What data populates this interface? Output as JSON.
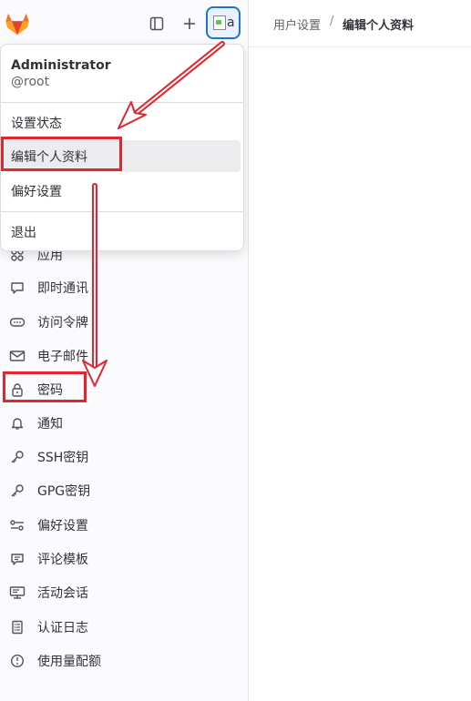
{
  "header": {
    "breadcrumb": [
      "用户设置",
      "编辑个人资料"
    ],
    "separator": "/"
  },
  "topbar": {
    "avatar_alt": "a",
    "icons": [
      "gitlab-logo",
      "sidebar-toggle-icon",
      "plus-icon",
      "avatar"
    ]
  },
  "user_menu": {
    "name": "Administrator",
    "username": "@root",
    "items": [
      "设置状态",
      "编辑个人资料",
      "偏好设置",
      "退出"
    ],
    "highlighted": "编辑个人资料"
  },
  "sidebar": {
    "items": [
      {
        "label": "应用",
        "icon": "applications-icon"
      },
      {
        "label": "即时通讯",
        "icon": "comment-icon"
      },
      {
        "label": "访问令牌",
        "icon": "token-icon"
      },
      {
        "label": "电子邮件",
        "icon": "mail-icon"
      },
      {
        "label": "密码",
        "icon": "lock-icon"
      },
      {
        "label": "通知",
        "icon": "bell-icon"
      },
      {
        "label": "SSH密钥",
        "icon": "key-icon"
      },
      {
        "label": "GPG密钥",
        "icon": "key-icon"
      },
      {
        "label": "偏好设置",
        "icon": "preferences-icon"
      },
      {
        "label": "评论模板",
        "icon": "comment-template-icon"
      },
      {
        "label": "活动会话",
        "icon": "monitor-icon"
      },
      {
        "label": "认证日志",
        "icon": "log-icon"
      },
      {
        "label": "使用量配额",
        "icon": "quota-icon"
      }
    ]
  },
  "colors": {
    "annotation": "#e4242e",
    "avatar_border": "#1f75cb",
    "logo_orange": "#e24329"
  }
}
